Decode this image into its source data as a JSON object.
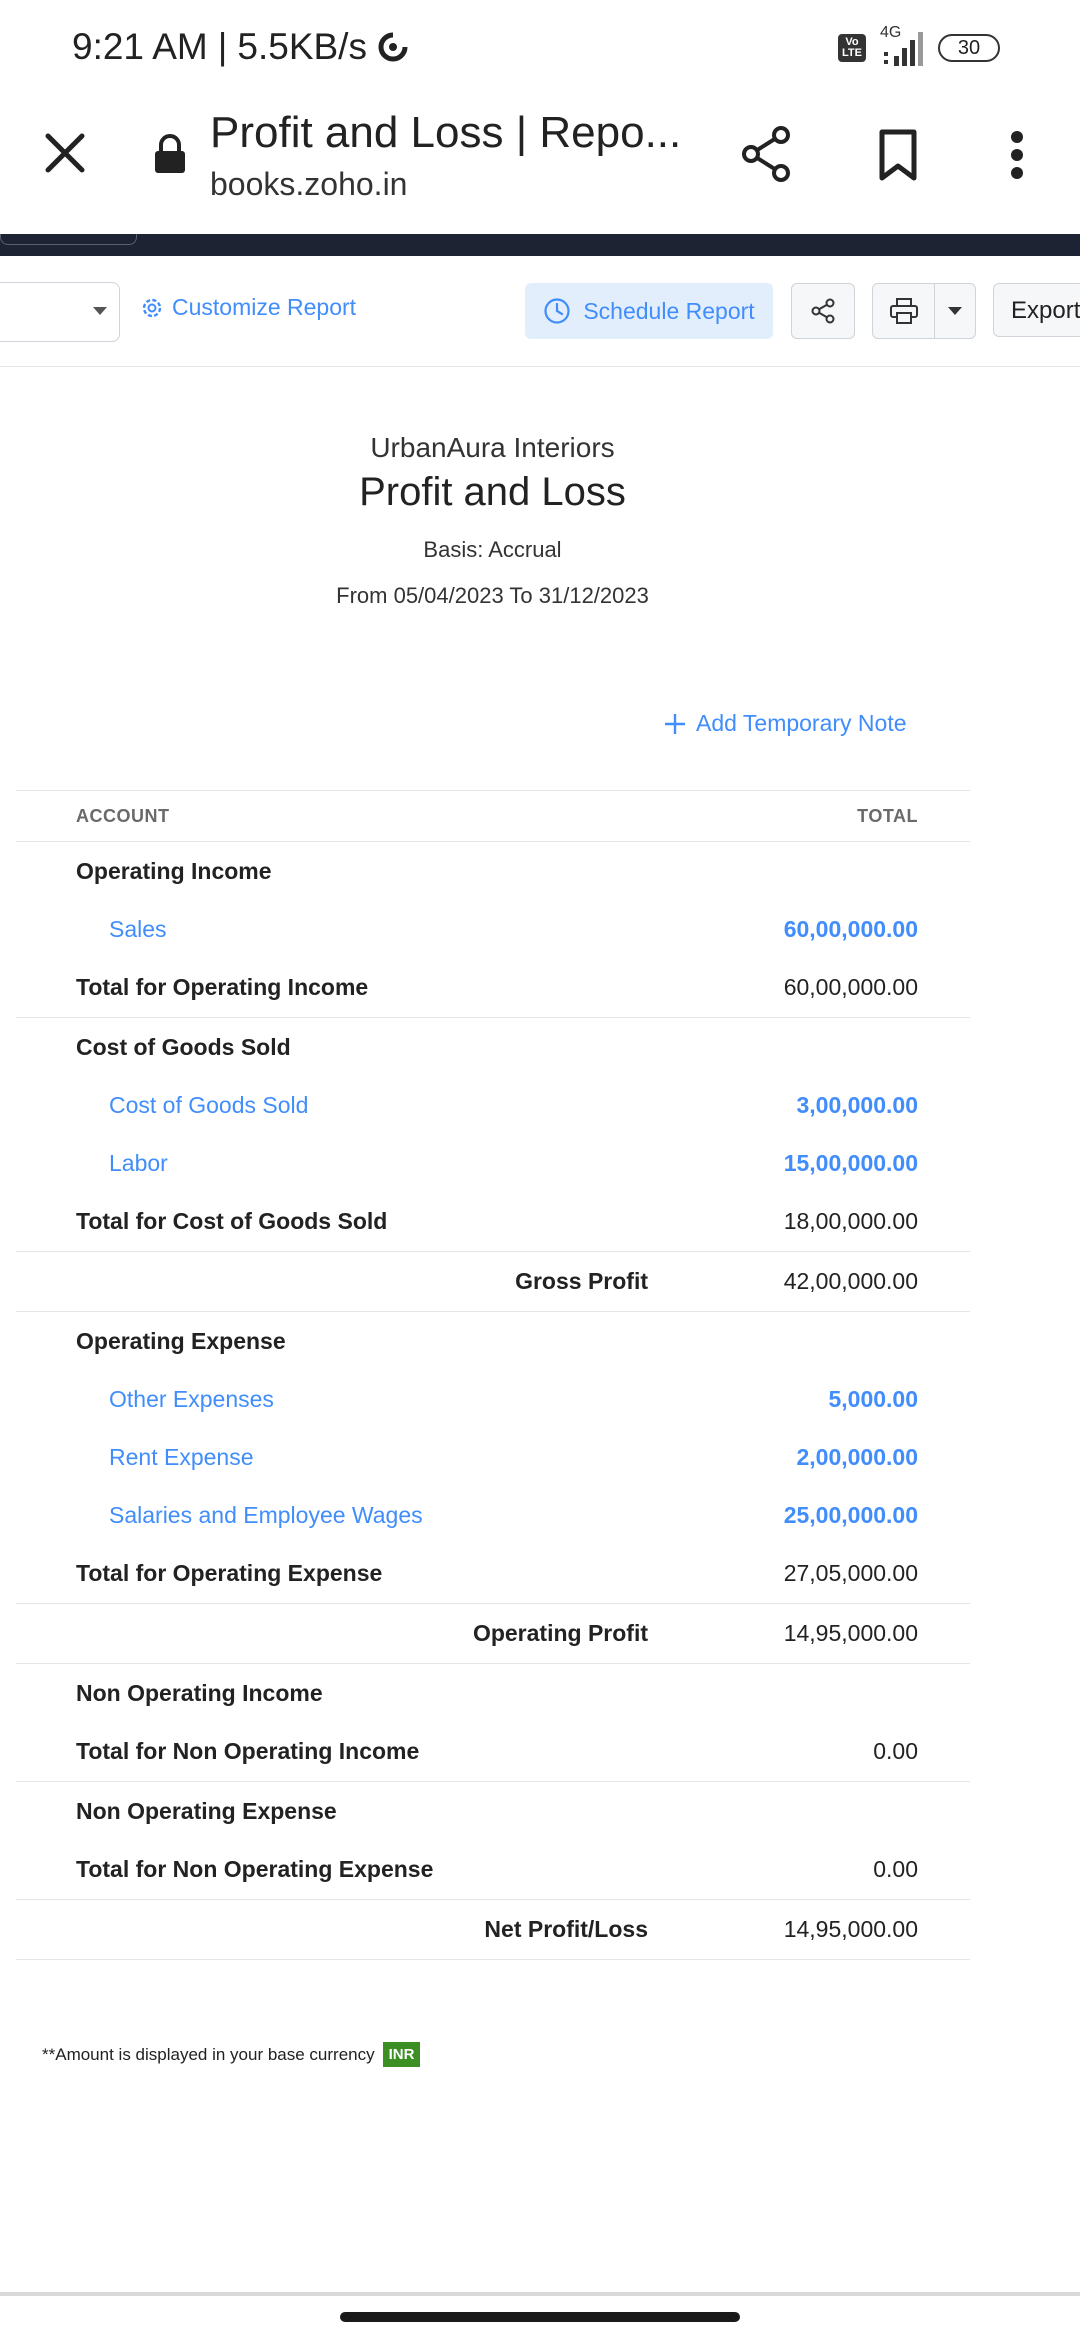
{
  "status_bar": {
    "time": "9:21 AM",
    "separator": "|",
    "speed": "5.5KB/s",
    "network": "4G",
    "volte_line1": "Vo",
    "volte_line2": "LTE",
    "battery": "30"
  },
  "browser": {
    "page_title": "Profit and Loss | Repo...",
    "url": "books.zoho.in"
  },
  "toolbar": {
    "customize_label": "Customize Report",
    "schedule_label": "Schedule Report",
    "export_label": "Export"
  },
  "report": {
    "company": "UrbanAura Interiors",
    "title": "Profit and Loss",
    "basis": "Basis: Accrual",
    "date_range": "From 05/04/2023 To 31/12/2023",
    "add_note_label": "Add Temporary Note",
    "col_account": "ACCOUNT",
    "col_total": "TOTAL",
    "rows": [
      {
        "type": "section",
        "label": "Operating Income",
        "amount": ""
      },
      {
        "type": "item",
        "label": "Sales",
        "amount": "60,00,000.00"
      },
      {
        "type": "total",
        "label": "Total for Operating Income",
        "amount": "60,00,000.00"
      },
      {
        "type": "section",
        "label": "Cost of Goods Sold",
        "amount": ""
      },
      {
        "type": "item",
        "label": "Cost of Goods Sold",
        "amount": "3,00,000.00"
      },
      {
        "type": "item",
        "label": "Labor",
        "amount": "15,00,000.00"
      },
      {
        "type": "total",
        "label": "Total for Cost of Goods Sold",
        "amount": "18,00,000.00"
      },
      {
        "type": "summary",
        "label": "Gross Profit",
        "amount": "42,00,000.00"
      },
      {
        "type": "section",
        "label": "Operating Expense",
        "amount": ""
      },
      {
        "type": "item",
        "label": "Other Expenses",
        "amount": "5,000.00"
      },
      {
        "type": "item",
        "label": "Rent Expense",
        "amount": "2,00,000.00"
      },
      {
        "type": "item",
        "label": "Salaries and Employee Wages",
        "amount": "25,00,000.00"
      },
      {
        "type": "total",
        "label": "Total for Operating Expense",
        "amount": "27,05,000.00"
      },
      {
        "type": "summary",
        "label": "Operating Profit",
        "amount": "14,95,000.00"
      },
      {
        "type": "section",
        "label": "Non Operating Income",
        "amount": ""
      },
      {
        "type": "total",
        "label": "Total for Non Operating Income",
        "amount": "0.00"
      },
      {
        "type": "section",
        "label": "Non Operating Expense",
        "amount": ""
      },
      {
        "type": "total",
        "label": "Total for Non Operating Expense",
        "amount": "0.00"
      },
      {
        "type": "summary",
        "label": "Net Profit/Loss",
        "amount": "14,95,000.00"
      }
    ],
    "footnote": "**Amount is displayed in your base currency",
    "currency_badge": "INR"
  },
  "colors": {
    "accent": "#408dfb",
    "dark_strip": "#1e2333",
    "currency_badge": "#3b8f23"
  },
  "icons": [
    "close-icon",
    "lock-icon",
    "share-icon",
    "bookmark-icon",
    "more-vert-icon",
    "gear-icon",
    "clock-icon",
    "print-icon",
    "plus-icon",
    "data-saver-icon",
    "signal-icon"
  ]
}
